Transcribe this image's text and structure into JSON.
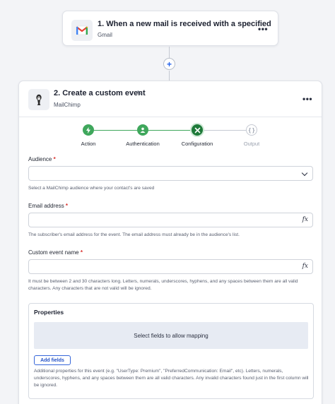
{
  "trigger": {
    "title": "1. When a new mail is received with a specified",
    "app_name": "Gmail"
  },
  "action": {
    "title": "2. Create a custom event",
    "app_name": "MailChimp"
  },
  "stepper": {
    "steps": [
      {
        "label": "Action",
        "state": "done"
      },
      {
        "label": "Authentication",
        "state": "done"
      },
      {
        "label": "Configuration",
        "state": "current"
      },
      {
        "label": "Output",
        "state": "pending"
      }
    ]
  },
  "form": {
    "audience": {
      "label": "Audience",
      "required_mark": "*",
      "value": "",
      "help": "Select a MailChimp audience where your contact's are saved"
    },
    "email": {
      "label": "Email address",
      "required_mark": "*",
      "value": "",
      "fx": "fx",
      "help": "The subscriber's email address for the event. The email address must already be in the audience's list."
    },
    "event_name": {
      "label": "Custom event name",
      "required_mark": "*",
      "value": "",
      "fx": "fx",
      "help": "It must be between 2 and 30 characters long. Letters, numerals, underscores, hyphens, and any spaces between them are all valid characters. Any characters that are not valid will be ignored."
    },
    "properties": {
      "title": "Properties",
      "drop_text": "Select fields to allow mapping",
      "add_button": "Add fields",
      "help": "Additional properties for this event (e.g. \"UserType: Premium\", \"PreferredCommunication: Email\", etc). Letters, numerals, underscores, hyphens, and any spaces between them are all valid characters. Any invalid characters found just in the first column will be ignored."
    }
  },
  "colors": {
    "gmail_red": "#ea4335",
    "step_done": "#3fa75c",
    "step_current": "#1f7a3a",
    "link_blue": "#2452c7",
    "required": "#d9302c"
  },
  "icons": {
    "trigger_app": "gmail-icon",
    "action_app": "mailchimp-icon",
    "more": "more-options-icon",
    "edit": "pencil-icon",
    "add": "plus-icon",
    "dropdown": "chevron-down-icon",
    "formula": "fx-icon"
  }
}
